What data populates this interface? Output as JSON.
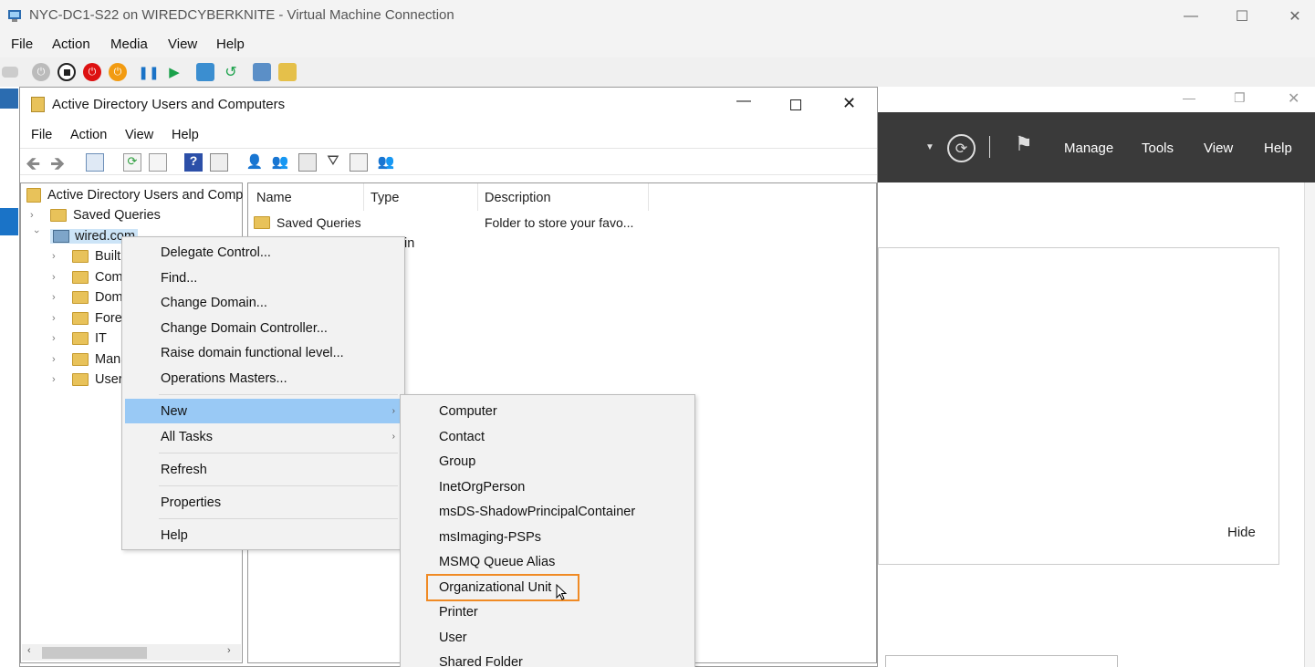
{
  "vm_window": {
    "title": "NYC-DC1-S22 on WIREDCYBERKNITE - Virtual Machine Connection",
    "menu": [
      "File",
      "Action",
      "Media",
      "View",
      "Help"
    ],
    "controls": {
      "minimize": "—",
      "maximize": "☐",
      "close": "✕"
    }
  },
  "server_manager": {
    "menu": [
      "Manage",
      "Tools",
      "View",
      "Help"
    ],
    "hide_label": "Hide"
  },
  "aduc": {
    "title": "Active Directory Users and Computers",
    "menu": [
      "File",
      "Action",
      "View",
      "Help"
    ],
    "tree": {
      "root": "Active Directory Users and Comp",
      "saved_queries": "Saved Queries",
      "domain": "wired.com",
      "children": [
        "Builti",
        "Comp",
        "Dom",
        "Forei",
        "IT",
        "Mana",
        "Users"
      ]
    },
    "list": {
      "columns": [
        "Name",
        "Type",
        "Description"
      ],
      "rows": [
        {
          "name": "Saved Queries",
          "type": "",
          "description": "Folder to store your favo..."
        }
      ],
      "partial_text": "in"
    }
  },
  "context_menu": {
    "items": [
      "Delegate Control...",
      "Find...",
      "Change Domain...",
      "Change Domain Controller...",
      "Raise domain functional level...",
      "Operations Masters...",
      "New",
      "All Tasks",
      "Refresh",
      "Properties",
      "Help"
    ]
  },
  "new_submenu": {
    "items": [
      "Computer",
      "Contact",
      "Group",
      "InetOrgPerson",
      "msDS-ShadowPrincipalContainer",
      "msImaging-PSPs",
      "MSMQ Queue Alias",
      "Organizational Unit",
      "Printer",
      "User",
      "Shared Folder"
    ]
  },
  "colors": {
    "highlight": "#99c9f5",
    "callout": "#f08a24",
    "sm_header": "#3a3a3a"
  }
}
